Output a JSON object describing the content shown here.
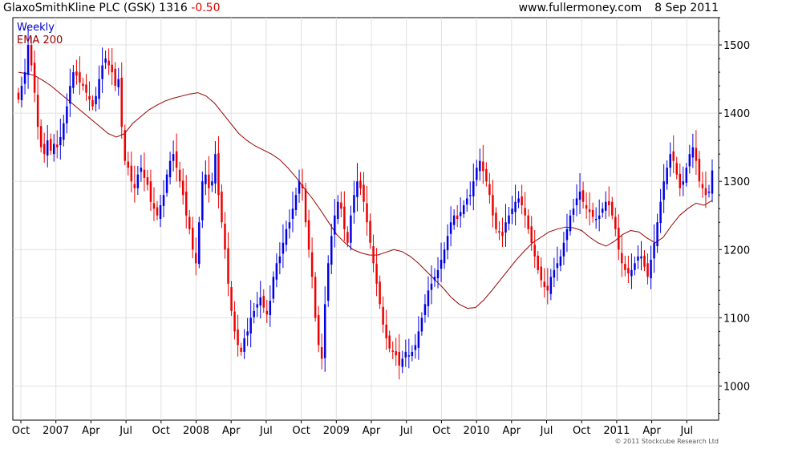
{
  "header": {
    "name": "GlaxoSmithKline PLC (GSK)",
    "price": "1316",
    "change": "-0.50",
    "website": "www.fullermoney.com",
    "date": "8 Sep 2011"
  },
  "copyright": "© 2011 Stockcube Research Ltd",
  "colors": {
    "up": "#0000e6",
    "down": "#ee0000",
    "ema": "#990000",
    "grid": "#e0e0e0"
  },
  "chart_data": {
    "type": "candlestick",
    "frequency": "weekly",
    "legend": [
      {
        "label": "Weekly",
        "color": "#0000cc"
      },
      {
        "label": "EMA 200",
        "color": "#990000"
      }
    ],
    "ylim": [
      950,
      1540
    ],
    "y_ticks": [
      1000,
      1100,
      1200,
      1300,
      1400,
      1500
    ],
    "x_ticks": [
      "Oct",
      "2007",
      "Apr",
      "Jul",
      "Oct",
      "2008",
      "Apr",
      "Jul",
      "Oct",
      "2009",
      "Apr",
      "Jul",
      "Oct",
      "2010",
      "Apr",
      "Jul",
      "Oct",
      "2011",
      "Apr",
      "Jul"
    ],
    "close": [
      1420,
      1440,
      1460,
      1500,
      1470,
      1430,
      1380,
      1350,
      1340,
      1360,
      1345,
      1355,
      1350,
      1365,
      1385,
      1410,
      1440,
      1460,
      1455,
      1445,
      1440,
      1430,
      1420,
      1410,
      1425,
      1450,
      1470,
      1480,
      1470,
      1460,
      1440,
      1450,
      1380,
      1330,
      1320,
      1300,
      1290,
      1310,
      1320,
      1305,
      1295,
      1270,
      1260,
      1250,
      1265,
      1280,
      1310,
      1330,
      1340,
      1320,
      1300,
      1280,
      1250,
      1230,
      1200,
      1180,
      1240,
      1300,
      1310,
      1290,
      1300,
      1340,
      1280,
      1240,
      1200,
      1150,
      1110,
      1080,
      1060,
      1050,
      1070,
      1080,
      1100,
      1110,
      1120,
      1130,
      1115,
      1105,
      1125,
      1160,
      1180,
      1190,
      1210,
      1230,
      1240,
      1260,
      1280,
      1300,
      1290,
      1240,
      1200,
      1160,
      1100,
      1060,
      1040,
      1120,
      1180,
      1220,
      1250,
      1270,
      1260,
      1230,
      1210,
      1250,
      1280,
      1300,
      1290,
      1270,
      1240,
      1210,
      1180,
      1150,
      1120,
      1090,
      1070,
      1055,
      1050,
      1045,
      1030,
      1040,
      1050,
      1045,
      1050,
      1060,
      1080,
      1100,
      1120,
      1140,
      1150,
      1160,
      1170,
      1185,
      1200,
      1220,
      1240,
      1250,
      1245,
      1255,
      1265,
      1275,
      1280,
      1300,
      1320,
      1330,
      1315,
      1300,
      1280,
      1250,
      1230,
      1225,
      1220,
      1240,
      1250,
      1260,
      1270,
      1275,
      1265,
      1250,
      1230,
      1210,
      1190,
      1170,
      1155,
      1145,
      1140,
      1160,
      1170,
      1180,
      1190,
      1210,
      1230,
      1250,
      1260,
      1275,
      1285,
      1270,
      1260,
      1255,
      1248,
      1245,
      1250,
      1260,
      1270,
      1265,
      1250,
      1230,
      1200,
      1180,
      1170,
      1165,
      1170,
      1180,
      1190,
      1190,
      1175,
      1160,
      1185,
      1210,
      1240,
      1270,
      1300,
      1320,
      1340,
      1330,
      1310,
      1290,
      1300,
      1320,
      1340,
      1350,
      1330,
      1300,
      1290,
      1280,
      1285,
      1316
    ],
    "ema200": [
      1460,
      1458,
      1455,
      1448,
      1440,
      1430,
      1420,
      1410,
      1400,
      1390,
      1380,
      1370,
      1365,
      1370,
      1385,
      1395,
      1405,
      1412,
      1418,
      1422,
      1425,
      1428,
      1430,
      1425,
      1415,
      1400,
      1385,
      1370,
      1360,
      1352,
      1346,
      1340,
      1332,
      1320,
      1306,
      1290,
      1275,
      1258,
      1240,
      1222,
      1210,
      1200,
      1195,
      1192,
      1192,
      1196,
      1200,
      1197,
      1190,
      1180,
      1168,
      1156,
      1144,
      1130,
      1120,
      1114,
      1115,
      1126,
      1140,
      1155,
      1170,
      1185,
      1198,
      1210,
      1218,
      1226,
      1230,
      1233,
      1232,
      1228,
      1218,
      1210,
      1205,
      1212,
      1222,
      1228,
      1226,
      1217,
      1210,
      1218,
      1235,
      1250,
      1260,
      1268,
      1265,
      1272
    ]
  }
}
